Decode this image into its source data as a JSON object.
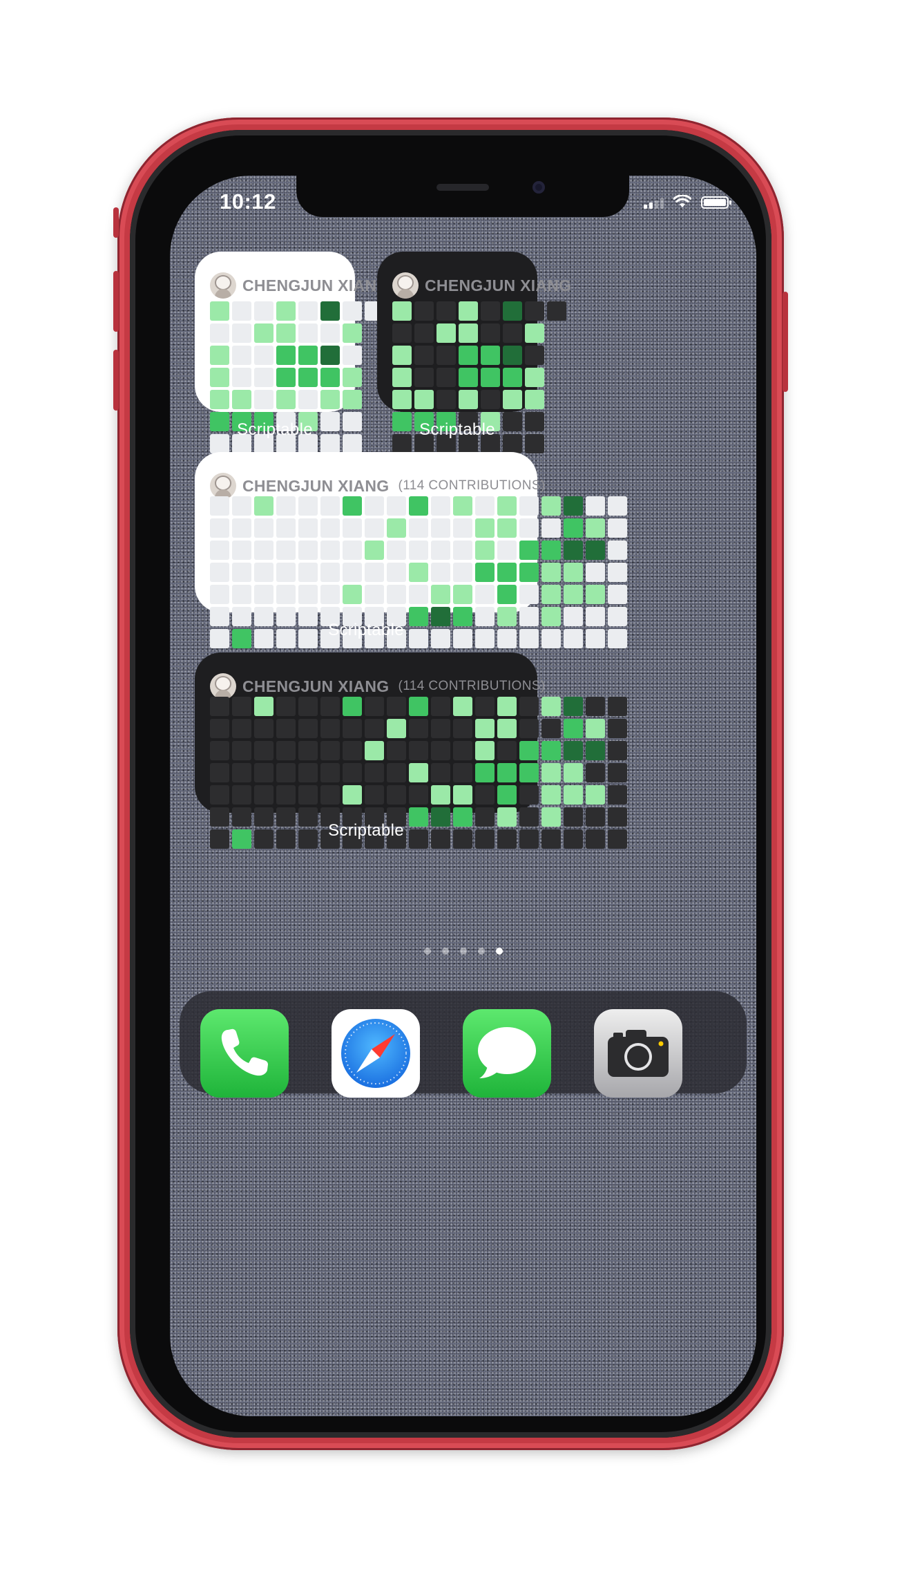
{
  "status_bar": {
    "time": "10:12"
  },
  "widget_user": "CHENGJUN XIANG",
  "widget_contributions": "(114 CONTRIBUTIONS)",
  "widget_app_label": "Scriptable",
  "palette": {
    "level0_light": "#ebedf0",
    "level0_dark": "#2d2d2f",
    "level1": "#9be9a8",
    "level2": "#40c463",
    "level3": "#30a14e",
    "level4": "#216e39"
  },
  "small_grid": [
    "1001040",
    "0011001",
    "1002240",
    "1002221",
    "1101011",
    "2220100",
    "0000000"
  ],
  "small_last_column": [
    0,
    0,
    0,
    0,
    1,
    0,
    0
  ],
  "large_grid": [
    "0010002002010101400",
    "0000000010001100210",
    "0000000100001022440",
    "0000000001002221100",
    "0000001000110201110",
    "0000000002420101000",
    "0200000000000000000"
  ],
  "page_dots": {
    "count": 5,
    "active_index": 4
  },
  "dock_apps": [
    "Phone",
    "Safari",
    "Messages",
    "Camera"
  ]
}
